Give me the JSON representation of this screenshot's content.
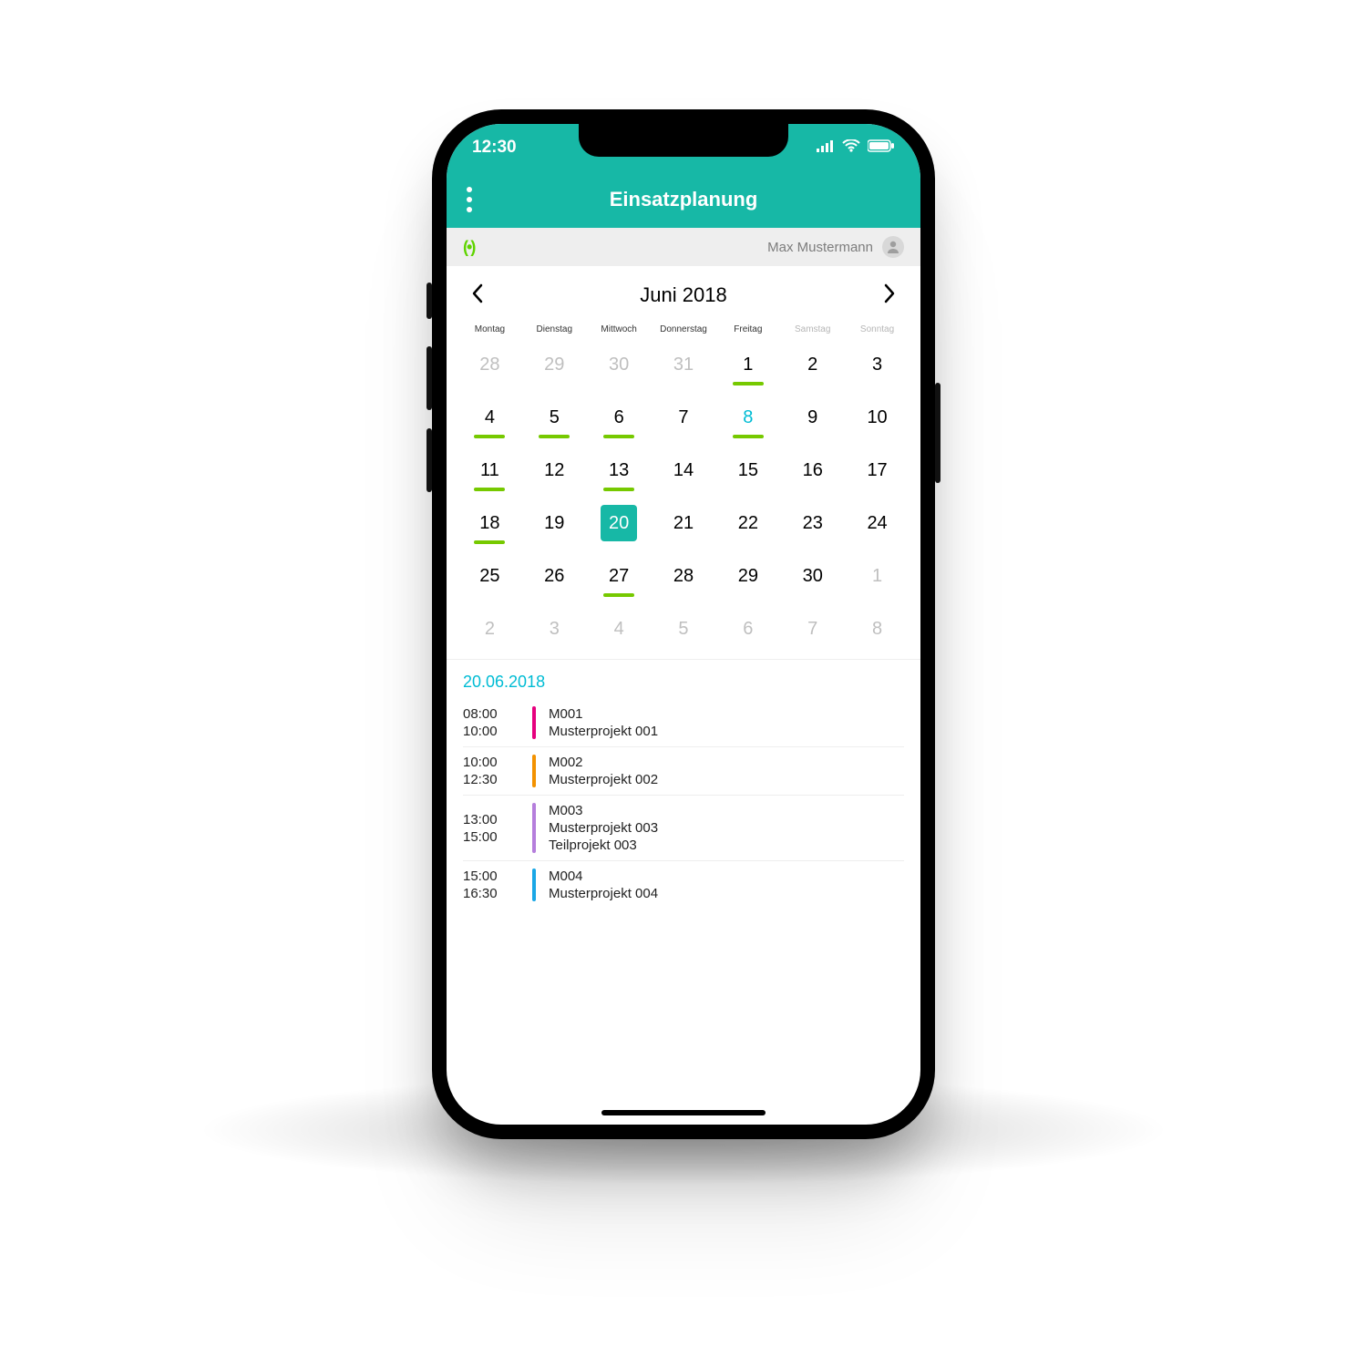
{
  "colors": {
    "accent": "#17b8a6",
    "mark": "#76c900",
    "cyan": "#00bcd4"
  },
  "status": {
    "time": "12:30"
  },
  "header": {
    "title": "Einsatzplanung"
  },
  "user": {
    "name": "Max Mustermann"
  },
  "month": {
    "label": "Juni 2018"
  },
  "dow": [
    "Montag",
    "Dienstag",
    "Mittwoch",
    "Donnerstag",
    "Freitag",
    "Samstag",
    "Sonntag"
  ],
  "weeks": [
    [
      {
        "n": "28",
        "other": true
      },
      {
        "n": "29",
        "other": true
      },
      {
        "n": "30",
        "other": true
      },
      {
        "n": "31",
        "other": true
      },
      {
        "n": "1",
        "mark": true
      },
      {
        "n": "2"
      },
      {
        "n": "3"
      }
    ],
    [
      {
        "n": "4",
        "mark": true
      },
      {
        "n": "5",
        "mark": true
      },
      {
        "n": "6",
        "mark": true
      },
      {
        "n": "7"
      },
      {
        "n": "8",
        "mark": true,
        "highlight": true
      },
      {
        "n": "9"
      },
      {
        "n": "10"
      }
    ],
    [
      {
        "n": "11",
        "mark": true
      },
      {
        "n": "12"
      },
      {
        "n": "13",
        "mark": true
      },
      {
        "n": "14"
      },
      {
        "n": "15"
      },
      {
        "n": "16"
      },
      {
        "n": "17"
      }
    ],
    [
      {
        "n": "18",
        "mark": true
      },
      {
        "n": "19"
      },
      {
        "n": "20",
        "selected": true
      },
      {
        "n": "21"
      },
      {
        "n": "22"
      },
      {
        "n": "23"
      },
      {
        "n": "24"
      }
    ],
    [
      {
        "n": "25"
      },
      {
        "n": "26"
      },
      {
        "n": "27",
        "mark": true
      },
      {
        "n": "28"
      },
      {
        "n": "29"
      },
      {
        "n": "30"
      },
      {
        "n": "1",
        "other": true
      }
    ],
    [
      {
        "n": "2",
        "other": true
      },
      {
        "n": "3",
        "other": true
      },
      {
        "n": "4",
        "other": true
      },
      {
        "n": "5",
        "other": true
      },
      {
        "n": "6",
        "other": true
      },
      {
        "n": "7",
        "other": true
      },
      {
        "n": "8",
        "other": true
      }
    ]
  ],
  "agenda": {
    "date": "20.06.2018",
    "items": [
      {
        "start": "08:00",
        "end": "10:00",
        "code": "M001",
        "line1": "Musterprojekt 001",
        "line2": "",
        "color": "#e6007e"
      },
      {
        "start": "10:00",
        "end": "12:30",
        "code": "M002",
        "line1": "Musterprojekt 002",
        "line2": "",
        "color": "#f39200"
      },
      {
        "start": "13:00",
        "end": "15:00",
        "code": "M003",
        "line1": "Musterprojekt 003",
        "line2": "Teilprojekt 003",
        "color": "#b57edc"
      },
      {
        "start": "15:00",
        "end": "16:30",
        "code": "M004",
        "line1": "Musterprojekt 004",
        "line2": "",
        "color": "#1aa7e6"
      }
    ]
  }
}
